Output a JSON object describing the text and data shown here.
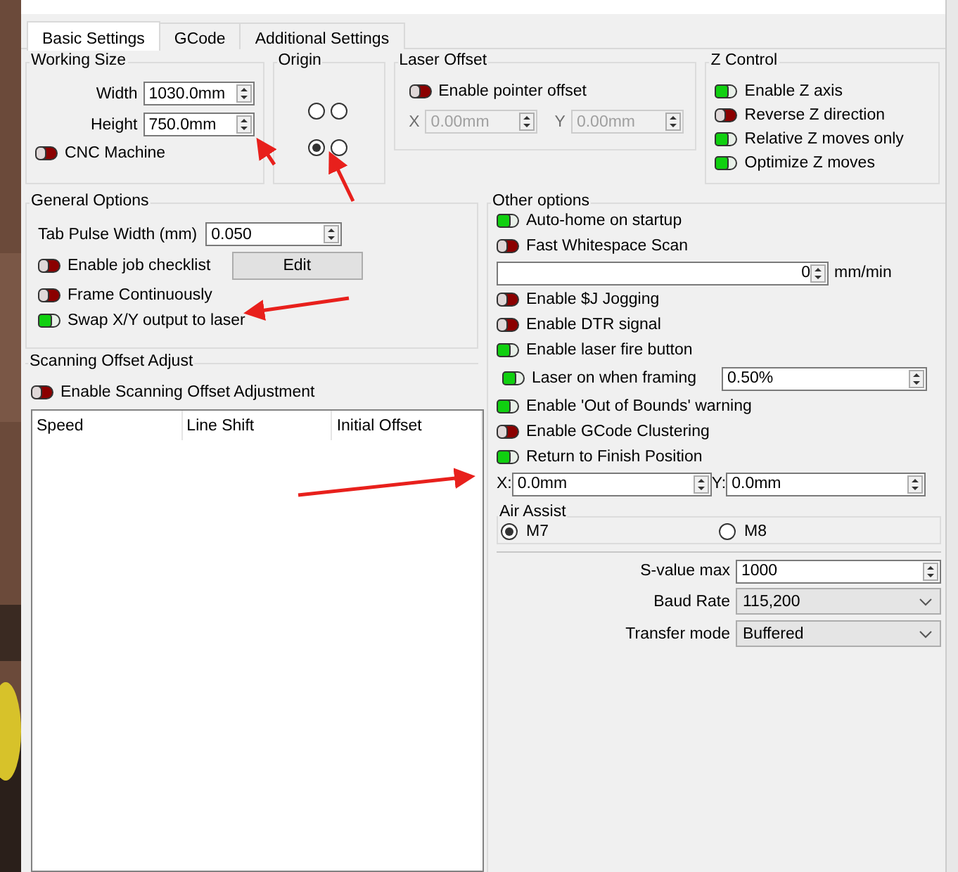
{
  "tabs": [
    {
      "label": "Basic Settings",
      "selected": true
    },
    {
      "label": "GCode",
      "selected": false
    },
    {
      "label": "Additional Settings",
      "selected": false
    }
  ],
  "working_size": {
    "title": "Working Size",
    "fields": [
      {
        "label": "Width",
        "value": "1030.0mm"
      },
      {
        "label": "Height",
        "value": "750.0mm"
      }
    ],
    "toggle": {
      "label": "CNC Machine",
      "on": false
    }
  },
  "origin": {
    "title": "Origin",
    "options": [
      {
        "selected": false
      },
      {
        "selected": false
      },
      {
        "selected": true
      },
      {
        "selected": false
      }
    ]
  },
  "laser_offset": {
    "title": "Laser Offset",
    "toggle": {
      "label": "Enable pointer offset",
      "on": false
    },
    "fields": [
      {
        "label": "X",
        "value": "0.00mm",
        "disabled": true
      },
      {
        "label": "Y",
        "value": "0.00mm",
        "disabled": true
      }
    ]
  },
  "z_control": {
    "title": "Z Control",
    "toggles": [
      {
        "label": "Enable Z axis",
        "on": true
      },
      {
        "label": "Reverse Z direction",
        "on": false
      },
      {
        "label": "Relative Z moves only",
        "on": true
      },
      {
        "label": "Optimize Z moves",
        "on": true
      }
    ]
  },
  "general_options": {
    "title": "General Options",
    "tab_pulse": {
      "label": "Tab Pulse Width (mm)",
      "value": "0.050"
    },
    "toggles": [
      {
        "label": "Enable job checklist",
        "on": false,
        "button": "Edit"
      },
      {
        "label": "Frame Continuously",
        "on": false
      },
      {
        "label": "Swap X/Y output to laser",
        "on": true
      }
    ]
  },
  "scanning_offset": {
    "title": "Scanning Offset Adjust",
    "toggle": {
      "label": "Enable Scanning Offset Adjustment",
      "on": false
    },
    "columns": [
      "Speed",
      "Line Shift",
      "Initial Offset"
    ]
  },
  "other_options": {
    "title": "Other options",
    "items": [
      {
        "kind": "toggle",
        "label": "Auto-home on startup",
        "on": true
      },
      {
        "kind": "toggle",
        "label": "Fast Whitespace Scan",
        "on": false
      },
      {
        "kind": "speed",
        "value": "0",
        "unit": "mm/min"
      },
      {
        "kind": "toggle",
        "label": "Enable $J Jogging",
        "on": false
      },
      {
        "kind": "toggle",
        "label": "Enable DTR signal",
        "on": false
      },
      {
        "kind": "toggle",
        "label": "Enable laser fire button",
        "on": true
      },
      {
        "kind": "togglefield",
        "label": "Laser on when framing",
        "on": true,
        "value": "0.50%"
      },
      {
        "kind": "toggle",
        "label": "Enable 'Out of Bounds' warning",
        "on": true
      },
      {
        "kind": "toggle",
        "label": "Enable GCode Clustering",
        "on": false
      },
      {
        "kind": "toggle",
        "label": "Return to Finish Position",
        "on": true
      },
      {
        "kind": "xy",
        "fields": [
          {
            "label": "X:",
            "value": "0.0mm"
          },
          {
            "label": "Y:",
            "value": "0.0mm"
          }
        ]
      },
      {
        "kind": "radios",
        "title": "Air Assist",
        "options": [
          {
            "label": "M7",
            "selected": true
          },
          {
            "label": "M8",
            "selected": false
          }
        ]
      },
      {
        "kind": "spin",
        "label": "S-value max",
        "value": "1000"
      },
      {
        "kind": "select",
        "label": "Baud Rate",
        "value": "115,200"
      },
      {
        "kind": "select",
        "label": "Transfer mode",
        "value": "Buffered"
      }
    ]
  }
}
